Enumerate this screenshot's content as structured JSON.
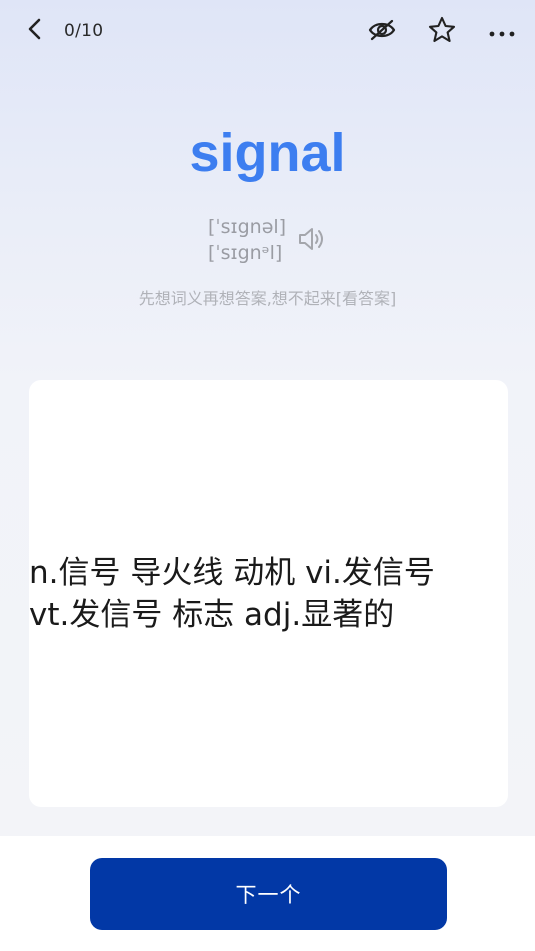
{
  "header": {
    "progress": "0/10",
    "icons": {
      "back": "chevron-left-icon",
      "hide": "eye-off-icon",
      "favorite": "star-icon",
      "more": "more-horizontal-icon"
    }
  },
  "word": {
    "text": "signal",
    "phonetic_uk": "[ˈsɪgnəl]",
    "phonetic_us": "[ˈsɪgnᵊl]",
    "speaker_icon": "speaker-icon"
  },
  "hint": "先想词义再想答案,想不起来[看答案]",
  "card": {
    "definition": "n.信号 导火线 动机 vi.发信号\nvt.发信号 标志 adj.显著的"
  },
  "footer": {
    "next_label": "下一个"
  },
  "colors": {
    "word": "#3d7ef0",
    "button": "#0238a6",
    "background_top": "#dfe5f7",
    "card": "#ffffff"
  }
}
